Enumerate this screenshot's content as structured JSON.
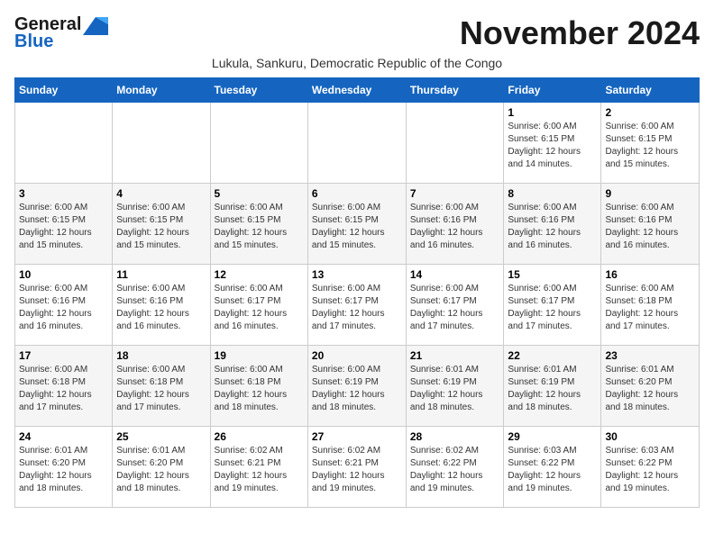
{
  "logo": {
    "general": "General",
    "blue": "Blue",
    "tagline": ""
  },
  "title": "November 2024",
  "subtitle": "Lukula, Sankuru, Democratic Republic of the Congo",
  "days_of_week": [
    "Sunday",
    "Monday",
    "Tuesday",
    "Wednesday",
    "Thursday",
    "Friday",
    "Saturday"
  ],
  "weeks": [
    [
      {
        "day": "",
        "info": ""
      },
      {
        "day": "",
        "info": ""
      },
      {
        "day": "",
        "info": ""
      },
      {
        "day": "",
        "info": ""
      },
      {
        "day": "",
        "info": ""
      },
      {
        "day": "1",
        "info": "Sunrise: 6:00 AM\nSunset: 6:15 PM\nDaylight: 12 hours and 14 minutes."
      },
      {
        "day": "2",
        "info": "Sunrise: 6:00 AM\nSunset: 6:15 PM\nDaylight: 12 hours and 15 minutes."
      }
    ],
    [
      {
        "day": "3",
        "info": "Sunrise: 6:00 AM\nSunset: 6:15 PM\nDaylight: 12 hours and 15 minutes."
      },
      {
        "day": "4",
        "info": "Sunrise: 6:00 AM\nSunset: 6:15 PM\nDaylight: 12 hours and 15 minutes."
      },
      {
        "day": "5",
        "info": "Sunrise: 6:00 AM\nSunset: 6:15 PM\nDaylight: 12 hours and 15 minutes."
      },
      {
        "day": "6",
        "info": "Sunrise: 6:00 AM\nSunset: 6:15 PM\nDaylight: 12 hours and 15 minutes."
      },
      {
        "day": "7",
        "info": "Sunrise: 6:00 AM\nSunset: 6:16 PM\nDaylight: 12 hours and 16 minutes."
      },
      {
        "day": "8",
        "info": "Sunrise: 6:00 AM\nSunset: 6:16 PM\nDaylight: 12 hours and 16 minutes."
      },
      {
        "day": "9",
        "info": "Sunrise: 6:00 AM\nSunset: 6:16 PM\nDaylight: 12 hours and 16 minutes."
      }
    ],
    [
      {
        "day": "10",
        "info": "Sunrise: 6:00 AM\nSunset: 6:16 PM\nDaylight: 12 hours and 16 minutes."
      },
      {
        "day": "11",
        "info": "Sunrise: 6:00 AM\nSunset: 6:16 PM\nDaylight: 12 hours and 16 minutes."
      },
      {
        "day": "12",
        "info": "Sunrise: 6:00 AM\nSunset: 6:17 PM\nDaylight: 12 hours and 16 minutes."
      },
      {
        "day": "13",
        "info": "Sunrise: 6:00 AM\nSunset: 6:17 PM\nDaylight: 12 hours and 17 minutes."
      },
      {
        "day": "14",
        "info": "Sunrise: 6:00 AM\nSunset: 6:17 PM\nDaylight: 12 hours and 17 minutes."
      },
      {
        "day": "15",
        "info": "Sunrise: 6:00 AM\nSunset: 6:17 PM\nDaylight: 12 hours and 17 minutes."
      },
      {
        "day": "16",
        "info": "Sunrise: 6:00 AM\nSunset: 6:18 PM\nDaylight: 12 hours and 17 minutes."
      }
    ],
    [
      {
        "day": "17",
        "info": "Sunrise: 6:00 AM\nSunset: 6:18 PM\nDaylight: 12 hours and 17 minutes."
      },
      {
        "day": "18",
        "info": "Sunrise: 6:00 AM\nSunset: 6:18 PM\nDaylight: 12 hours and 17 minutes."
      },
      {
        "day": "19",
        "info": "Sunrise: 6:00 AM\nSunset: 6:18 PM\nDaylight: 12 hours and 18 minutes."
      },
      {
        "day": "20",
        "info": "Sunrise: 6:00 AM\nSunset: 6:19 PM\nDaylight: 12 hours and 18 minutes."
      },
      {
        "day": "21",
        "info": "Sunrise: 6:01 AM\nSunset: 6:19 PM\nDaylight: 12 hours and 18 minutes."
      },
      {
        "day": "22",
        "info": "Sunrise: 6:01 AM\nSunset: 6:19 PM\nDaylight: 12 hours and 18 minutes."
      },
      {
        "day": "23",
        "info": "Sunrise: 6:01 AM\nSunset: 6:20 PM\nDaylight: 12 hours and 18 minutes."
      }
    ],
    [
      {
        "day": "24",
        "info": "Sunrise: 6:01 AM\nSunset: 6:20 PM\nDaylight: 12 hours and 18 minutes."
      },
      {
        "day": "25",
        "info": "Sunrise: 6:01 AM\nSunset: 6:20 PM\nDaylight: 12 hours and 18 minutes."
      },
      {
        "day": "26",
        "info": "Sunrise: 6:02 AM\nSunset: 6:21 PM\nDaylight: 12 hours and 19 minutes."
      },
      {
        "day": "27",
        "info": "Sunrise: 6:02 AM\nSunset: 6:21 PM\nDaylight: 12 hours and 19 minutes."
      },
      {
        "day": "28",
        "info": "Sunrise: 6:02 AM\nSunset: 6:22 PM\nDaylight: 12 hours and 19 minutes."
      },
      {
        "day": "29",
        "info": "Sunrise: 6:03 AM\nSunset: 6:22 PM\nDaylight: 12 hours and 19 minutes."
      },
      {
        "day": "30",
        "info": "Sunrise: 6:03 AM\nSunset: 6:22 PM\nDaylight: 12 hours and 19 minutes."
      }
    ]
  ]
}
